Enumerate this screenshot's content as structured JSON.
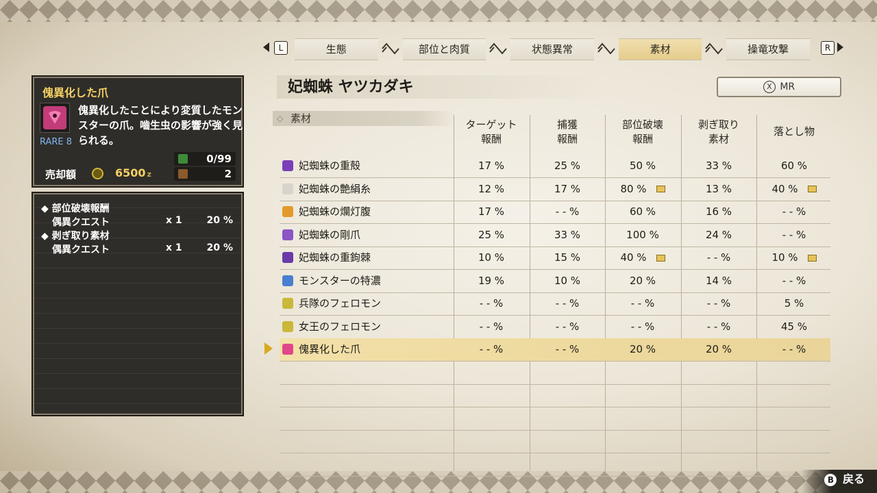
{
  "tabs": {
    "left_key": "L",
    "right_key": "R",
    "items": [
      "生態",
      "部位と肉質",
      "状態異常",
      "素材",
      "操竜攻撃"
    ],
    "active_index": 3
  },
  "info": {
    "title": "傀異化した爪",
    "description": "傀異化したことにより変質したモンスターの爪。嚙生虫の影響が強く見られる。",
    "rarity_label": "RARE",
    "rarity_value": "8",
    "owned": "0/99",
    "box": "2",
    "sell_label": "売却額",
    "sell_price": "6500",
    "currency": "z"
  },
  "rewards": [
    {
      "label": "◆ 部位破壊報酬",
      "mul": "",
      "pct": ""
    },
    {
      "label": "偶異クエスト",
      "mul": "x 1",
      "pct": "20 %"
    },
    {
      "label": "◆ 剥ぎ取り素材",
      "mul": "",
      "pct": ""
    },
    {
      "label": "偶異クエスト",
      "mul": "x 1",
      "pct": "20 %"
    }
  ],
  "monster": {
    "name": "妃蜘蛛 ヤツカダキ"
  },
  "mr_button": {
    "key": "X",
    "label": "MR"
  },
  "table": {
    "section_label": "素材",
    "columns": [
      {
        "line1": "ターゲット",
        "line2": "報酬"
      },
      {
        "line1": "捕獲",
        "line2": "報酬"
      },
      {
        "line1": "部位破壊",
        "line2": "報酬"
      },
      {
        "line1": "剥ぎ取り",
        "line2": "素材"
      },
      {
        "line1": "落とし物",
        "line2": ""
      }
    ],
    "rows": [
      {
        "name": "妃蜘蛛の重殻",
        "icon_color": "#7a3fb8",
        "values": [
          "17 %",
          "25 %",
          "50 %",
          "33 %",
          "60 %"
        ],
        "sub": [
          false,
          false,
          false,
          false,
          false
        ]
      },
      {
        "name": "妃蜘蛛の艶絹糸",
        "icon_color": "#d8d4cc",
        "values": [
          "12 %",
          "17 %",
          "80 %",
          "13 %",
          "40 %"
        ],
        "sub": [
          false,
          false,
          true,
          false,
          true
        ]
      },
      {
        "name": "妃蜘蛛の爛灯腹",
        "icon_color": "#e39a2a",
        "values": [
          "17 %",
          "- - %",
          "60 %",
          "16 %",
          "- - %"
        ],
        "sub": [
          false,
          false,
          false,
          false,
          false
        ]
      },
      {
        "name": "妃蜘蛛の剛爪",
        "icon_color": "#8a55c4",
        "values": [
          "25 %",
          "33 %",
          "100 %",
          "24 %",
          "- - %"
        ],
        "sub": [
          false,
          false,
          false,
          false,
          false
        ]
      },
      {
        "name": "妃蜘蛛の重鉤棘",
        "icon_color": "#6a3aa8",
        "values": [
          "10 %",
          "15 %",
          "40 %",
          "- - %",
          "10 %"
        ],
        "sub": [
          false,
          false,
          true,
          false,
          true
        ]
      },
      {
        "name": "モンスターの特濃",
        "icon_color": "#4a7fd0",
        "values": [
          "19 %",
          "10 %",
          "20 %",
          "14 %",
          "- - %"
        ],
        "sub": [
          false,
          false,
          false,
          false,
          false
        ]
      },
      {
        "name": "兵隊のフェロモン",
        "icon_color": "#c9b83a",
        "values": [
          "- - %",
          "- - %",
          "- - %",
          "- - %",
          "5 %"
        ],
        "sub": [
          false,
          false,
          false,
          false,
          false
        ]
      },
      {
        "name": "女王のフェロモン",
        "icon_color": "#c9b83a",
        "values": [
          "- - %",
          "- - %",
          "- - %",
          "- - %",
          "45 %"
        ],
        "sub": [
          false,
          false,
          false,
          false,
          false
        ]
      },
      {
        "name": "傀異化した爪",
        "icon_color": "#e0468a",
        "values": [
          "- - %",
          "- - %",
          "20 %",
          "20 %",
          "- - %"
        ],
        "sub": [
          false,
          false,
          false,
          false,
          false
        ],
        "selected": true
      }
    ]
  },
  "footer": {
    "back_key": "B",
    "back_label": "戻る"
  }
}
